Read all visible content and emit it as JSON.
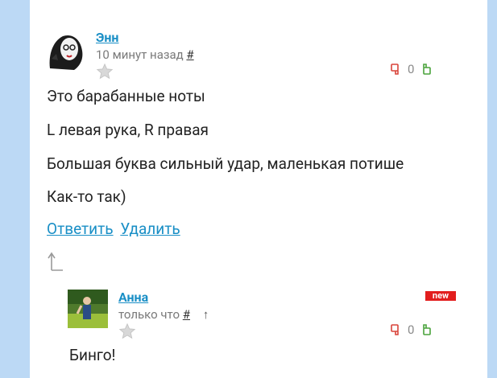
{
  "comments": [
    {
      "author": "Энн",
      "time": "10 минут назад",
      "permalink": "#",
      "rating": "0",
      "lines": [
        "Это барабанные ноты",
        "L левая рука, R правая",
        "Большая буква сильный удар, маленькая потише",
        "Как-то так)"
      ],
      "actions": [
        "Ответить",
        "Удалить"
      ]
    },
    {
      "author": "Анна",
      "time": "только что",
      "permalink": "#",
      "parent_arrow": "↑",
      "badge": "new",
      "rating": "0",
      "text": "Бинго!"
    }
  ],
  "colors": {
    "background": "#bcd9f5",
    "link": "#1a8fc6",
    "badge": "#e21e1e"
  }
}
